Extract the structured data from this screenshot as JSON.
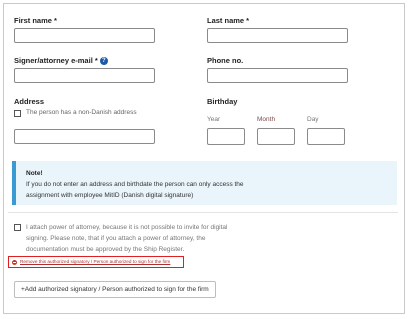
{
  "form": {
    "first_name_label": "First name *",
    "last_name_label": "Last name *",
    "email_label": "Signer/attorney e-mail *",
    "phone_label": "Phone no.",
    "address_label": "Address",
    "non_danish_label": "The person has a non-Danish address",
    "birthday_label": "Birthday",
    "year_label": "Year",
    "month_label": "Month",
    "day_label": "Day"
  },
  "note": {
    "title": "Note!",
    "line1": "If you do not enter an address and birthdate the person can only access the",
    "line2": "assignment with employee MitID (Danish digital signature)"
  },
  "poa": {
    "line1": "I attach power of attorney, because it is not possible to invite for digital",
    "line2": "signing. Please note, that if you attach a power of attorney, the",
    "line3": "documentation must be approved by the Ship Register."
  },
  "remove_link": "Remove this authorized signatory / Person authorized to sign for the firm",
  "add_button": "+Add authorized signatory / Person authorized to sign for the firm",
  "colors": {
    "note_bg": "#e9f5fb",
    "note_accent": "#3a9bd4",
    "remove_highlight": "#e02020",
    "help_icon": "#1a5aa8"
  }
}
